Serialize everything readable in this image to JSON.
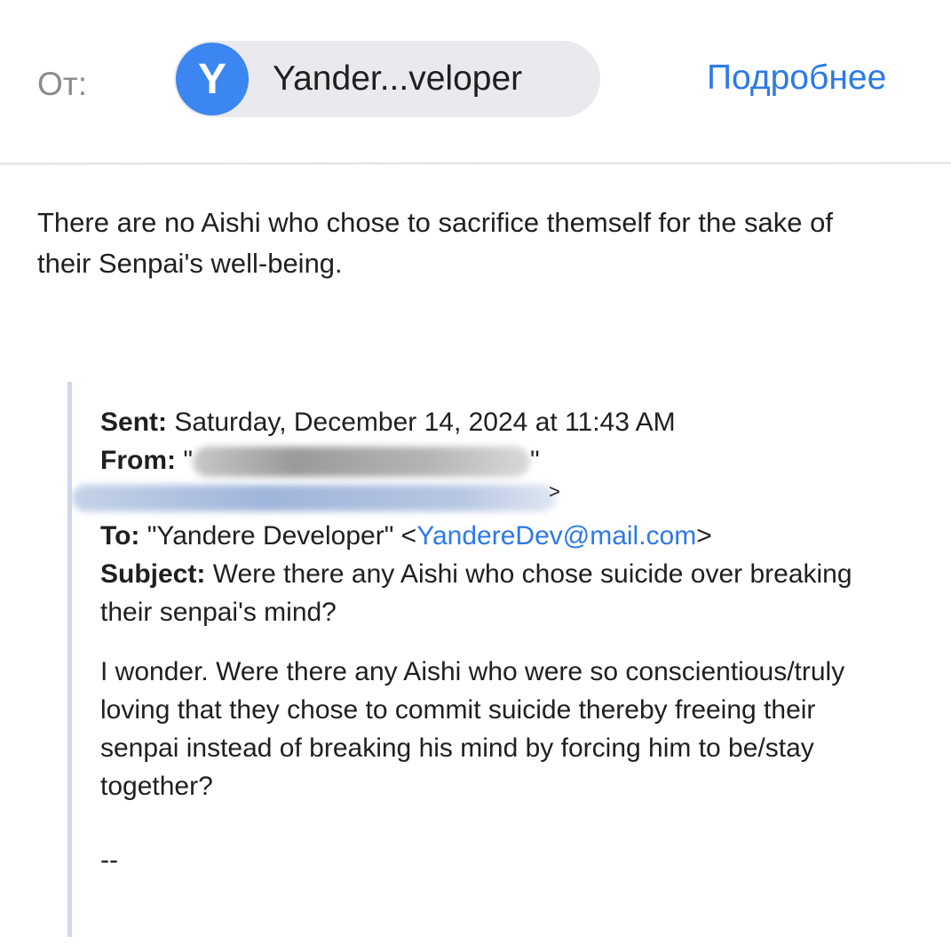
{
  "header": {
    "from_label": "От:",
    "avatar_letter": "Y",
    "sender_name": "Yander...veloper",
    "details_link": "Подробнее",
    "avatar_color": "#3b86f0",
    "link_color": "#2c79e8"
  },
  "reply": {
    "body": "There are no Aishi who chose to sacrifice themself for the sake of their Senpai's well-being."
  },
  "quoted": {
    "sent_label": "Sent:",
    "sent_value": "Saturday, December 14, 2024 at 11:43 AM",
    "from_label": "From:",
    "from_open_quote": "\"",
    "from_close_quote": "\"",
    "from_email_close": ">",
    "to_label": "To:",
    "to_name": "\"Yandere Developer\" <",
    "to_email": "YandereDev@mail.com",
    "to_close": ">",
    "subject_label": "Subject:",
    "subject_value": "Were there any Aishi who chose suicide over breaking their senpai's mind?",
    "body": "I wonder. Were there any Aishi who were so conscientious/truly loving that they chose to commit suicide thereby freeing their senpai instead of breaking his mind by forcing him to be/stay together?",
    "signature": "--"
  }
}
